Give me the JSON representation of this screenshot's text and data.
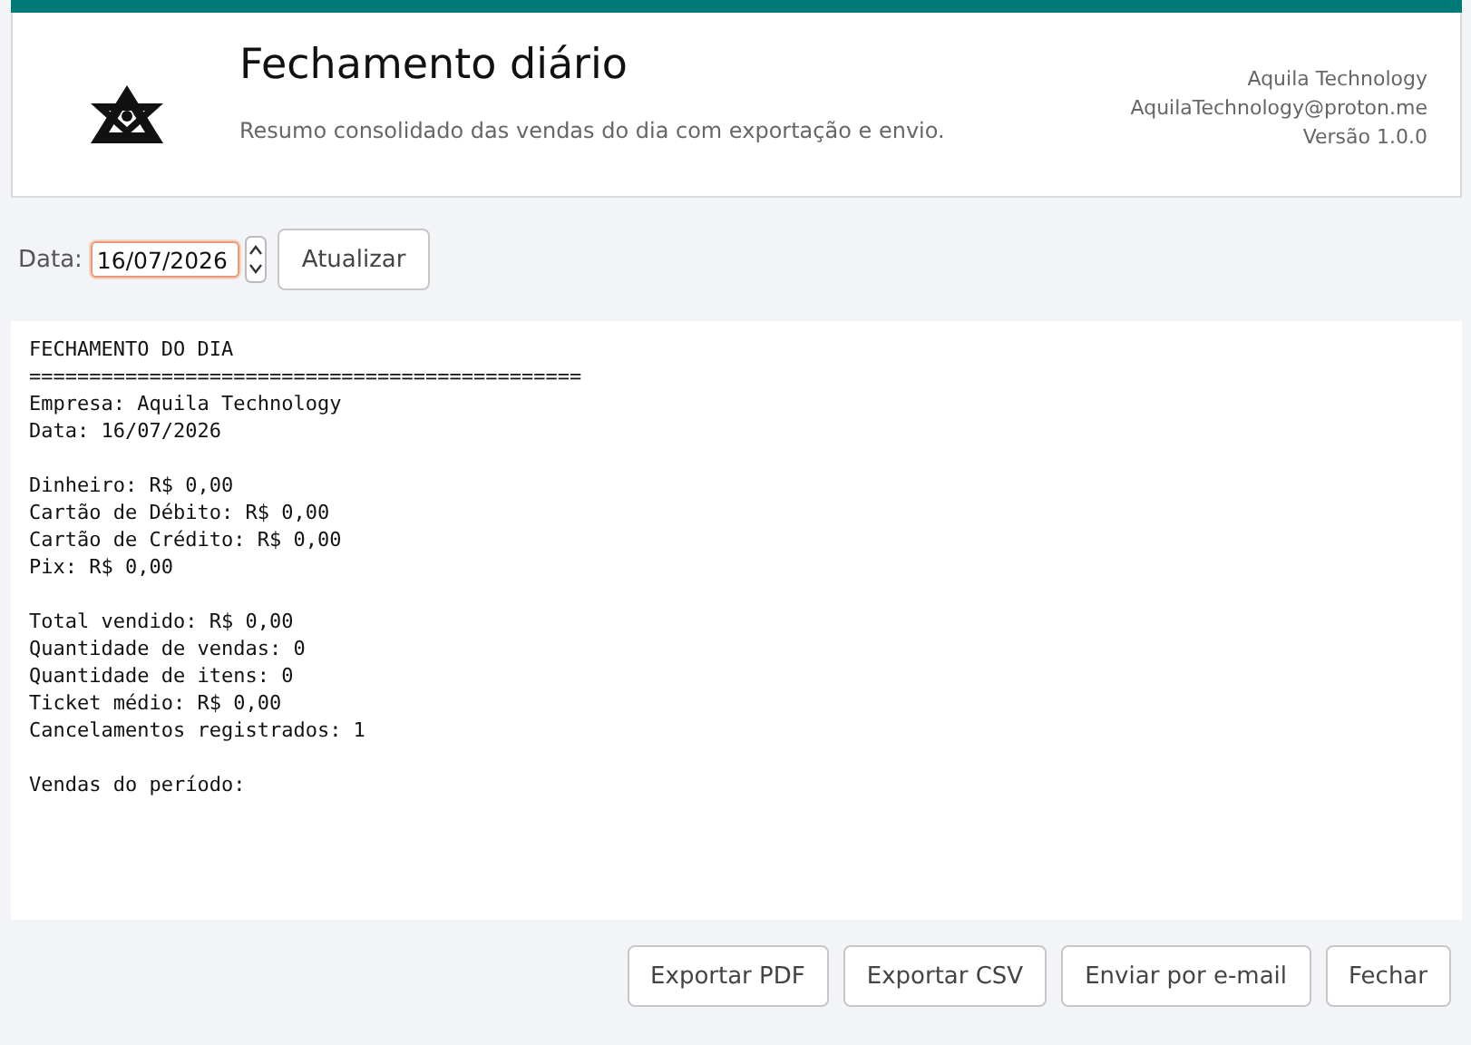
{
  "header": {
    "title": "Fechamento diário",
    "subtitle": "Resumo consolidado das vendas do dia com exportação e envio.",
    "company": "Aquila Technology",
    "email": "AquilaTechnology@proton.me",
    "version": "Versão 1.0.0"
  },
  "toolbar": {
    "date_label": "Data:",
    "date_value": "16/07/2026",
    "refresh_button": "Atualizar"
  },
  "report": {
    "title": "FECHAMENTO DO DIA",
    "rule": "==============================================",
    "sections": [
      [
        "Empresa: Aquila Technology",
        "Data: 16/07/2026"
      ],
      [
        "Dinheiro: R$ 0,00",
        "Cartão de Débito: R$ 0,00",
        "Cartão de Crédito: R$ 0,00",
        "Pix: R$ 0,00"
      ],
      [
        "Total vendido: R$ 0,00",
        "Quantidade de vendas: 0",
        "Quantidade de itens: 0",
        "Ticket médio: R$ 0,00",
        "Cancelamentos registrados: 1"
      ],
      [
        "Vendas do período:"
      ]
    ]
  },
  "buttons": [
    "Exportar PDF",
    "Exportar CSV",
    "Enviar por e-mail",
    "Fechar"
  ]
}
